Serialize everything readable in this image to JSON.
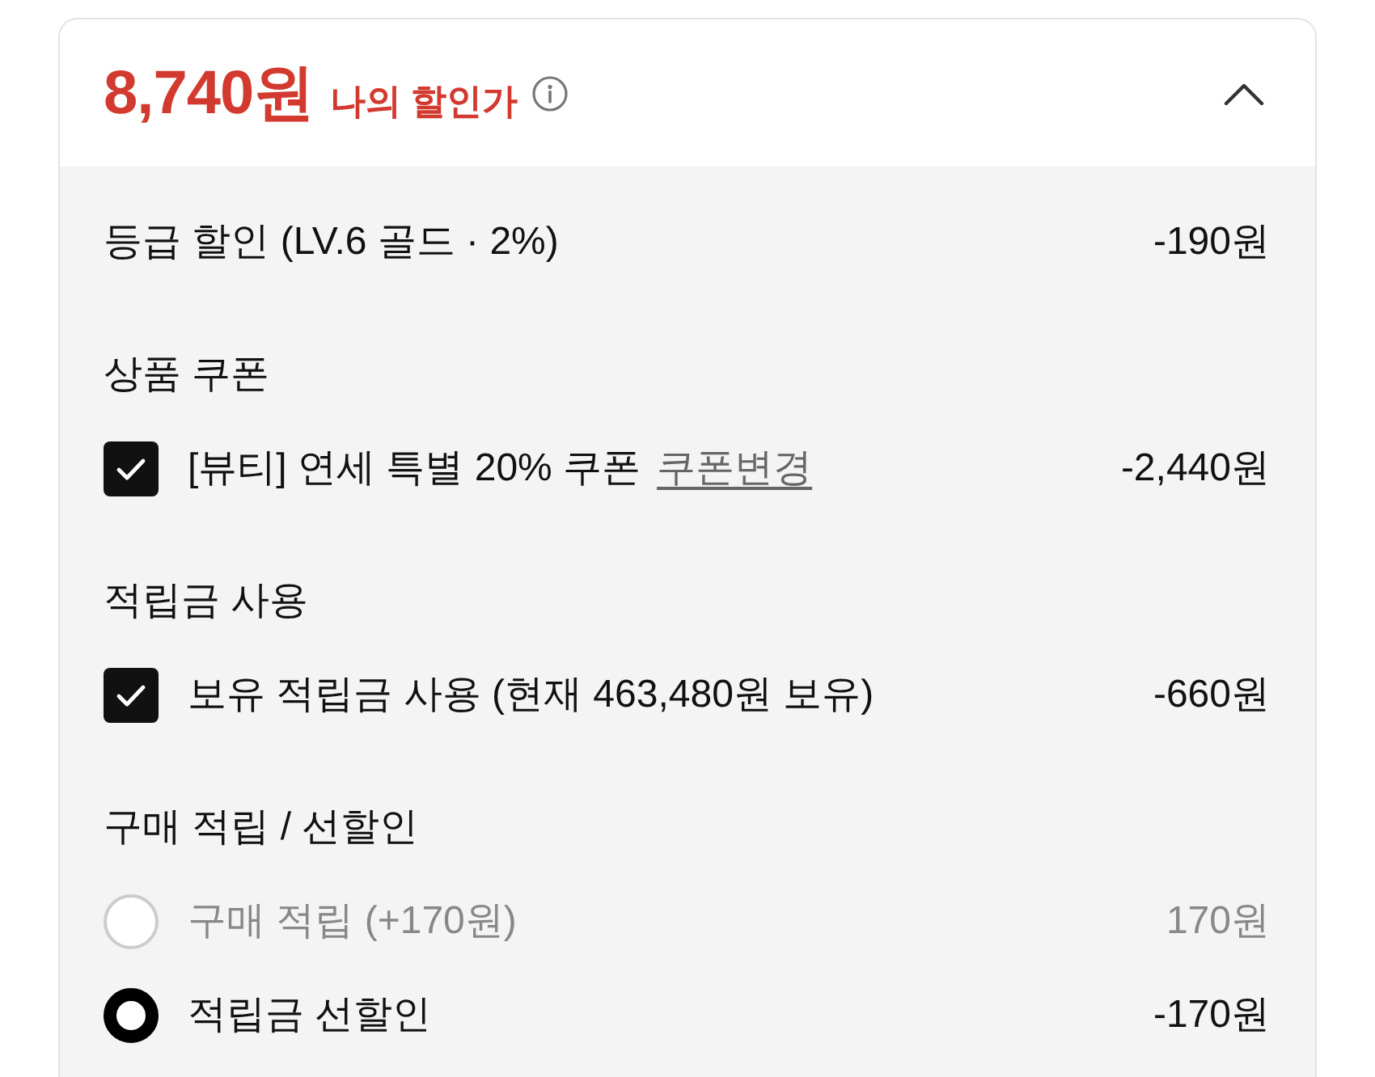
{
  "header": {
    "price": "8,740원",
    "label": "나의 할인가",
    "expanded": true
  },
  "sections": [
    {
      "rows": [
        {
          "kind": "plain",
          "label": "등급 할인 (LV.6 골드 · 2%)",
          "amount": "-190원"
        }
      ]
    },
    {
      "heading": "상품 쿠폰",
      "rows": [
        {
          "kind": "checkbox",
          "checked": true,
          "label": "[뷰티] 연세 특별 20% 쿠폰",
          "link": "쿠폰변경",
          "amount": "-2,440원"
        }
      ]
    },
    {
      "heading": "적립금 사용",
      "rows": [
        {
          "kind": "checkbox",
          "checked": true,
          "label": "보유 적립금 사용 (현재 463,480원 보유)",
          "amount": "-660원"
        }
      ]
    },
    {
      "heading": "구매 적립 / 선할인",
      "rows": [
        {
          "kind": "radio",
          "selected": false,
          "label": "구매 적립 (+170원)",
          "amount": "170원"
        },
        {
          "kind": "radio",
          "selected": true,
          "label": "적립금 선할인",
          "amount": "-170원"
        }
      ]
    }
  ]
}
